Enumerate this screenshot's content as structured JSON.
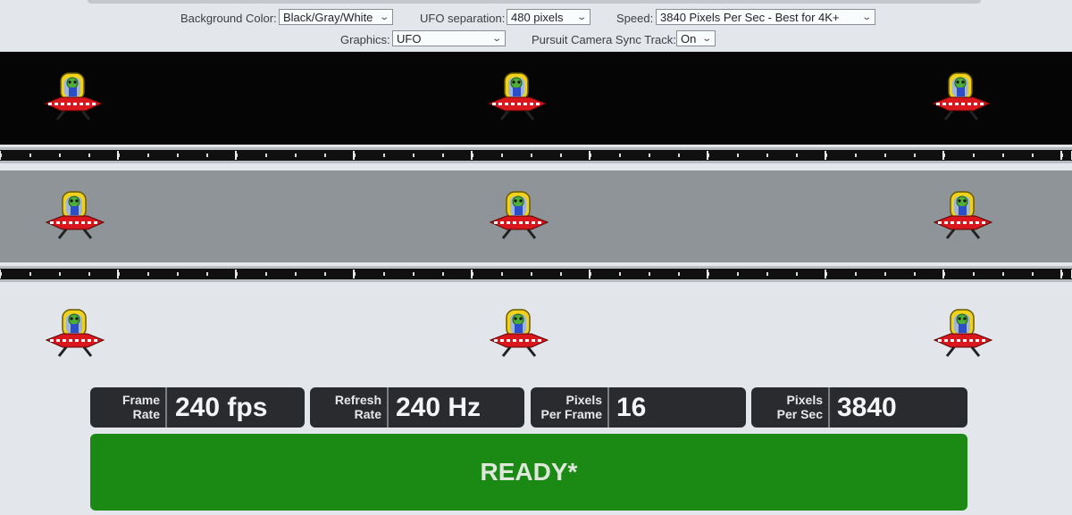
{
  "controls": {
    "background_color": {
      "label": "Background Color:",
      "value": "Black/Gray/White"
    },
    "ufo_separation": {
      "label": "UFO separation:",
      "value": "480 pixels"
    },
    "speed": {
      "label": "Speed:",
      "value": "3840 Pixels Per Sec - Best for 4K+"
    },
    "graphics": {
      "label": "Graphics:",
      "value": "UFO"
    },
    "pursuit_camera": {
      "label": "Pursuit Camera Sync Track:",
      "value": "On"
    }
  },
  "stats": [
    {
      "label_line1": "Frame",
      "label_line2": "Rate",
      "value": "240 fps"
    },
    {
      "label_line1": "Refresh",
      "label_line2": "Rate",
      "value": "240 Hz"
    },
    {
      "label_line1": "Pixels",
      "label_line2": "Per Frame",
      "value": "16"
    },
    {
      "label_line1": "Pixels",
      "label_line2": "Per Sec",
      "value": "3840"
    }
  ],
  "status": {
    "label": "READY*"
  },
  "colors": {
    "ready_green": "#1a8a14",
    "stat_bg": "#2a2b2e",
    "band_black": "#050505",
    "band_gray": "#8f9499",
    "band_white": "#e2e5e9"
  },
  "icons": [
    "ufo-alien-icon",
    "chevron-down-icon"
  ]
}
